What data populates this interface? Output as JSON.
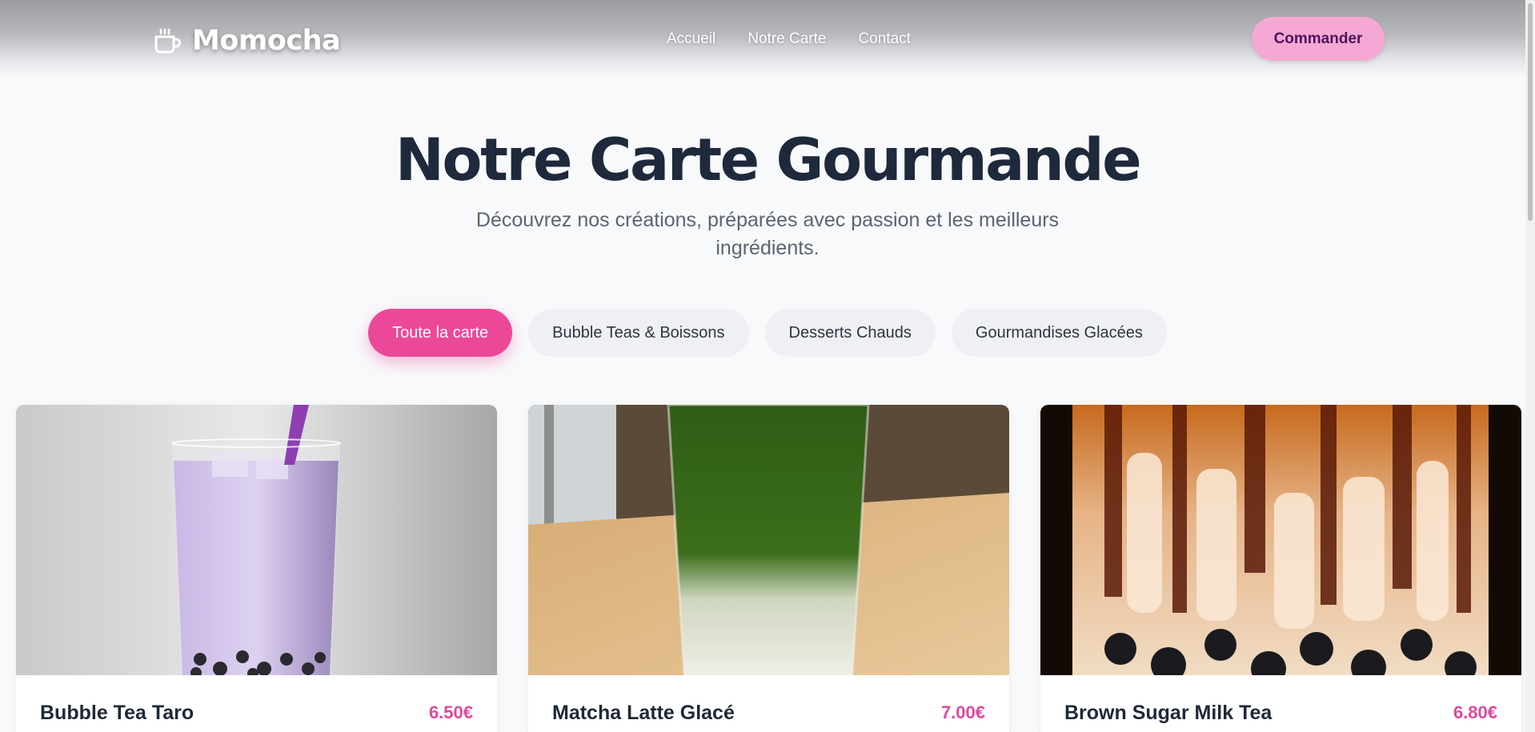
{
  "brand": {
    "name": "Momocha",
    "icon": "coffee-cup-icon"
  },
  "nav": {
    "items": [
      "Accueil",
      "Notre Carte",
      "Contact"
    ]
  },
  "header": {
    "order_label": "Commander"
  },
  "hero": {
    "title": "Notre Carte Gourmande",
    "subtitle": "Découvrez nos créations, préparées avec passion et les meilleurs ingrédients."
  },
  "filters": {
    "active": "Toute la carte",
    "items": [
      "Toute la carte",
      "Bubble Teas & Boissons",
      "Desserts Chauds",
      "Gourmandises Glacées"
    ]
  },
  "products": [
    {
      "name": "Bubble Tea Taro",
      "price": "6.50€"
    },
    {
      "name": "Matcha Latte Glacé",
      "price": "7.00€"
    },
    {
      "name": "Brown Sugar Milk Tea",
      "price": "6.80€"
    }
  ],
  "colors": {
    "accent": "#ec4899",
    "order_button": "#f5a8d3",
    "title": "#1e293b",
    "price": "#e0479e"
  }
}
